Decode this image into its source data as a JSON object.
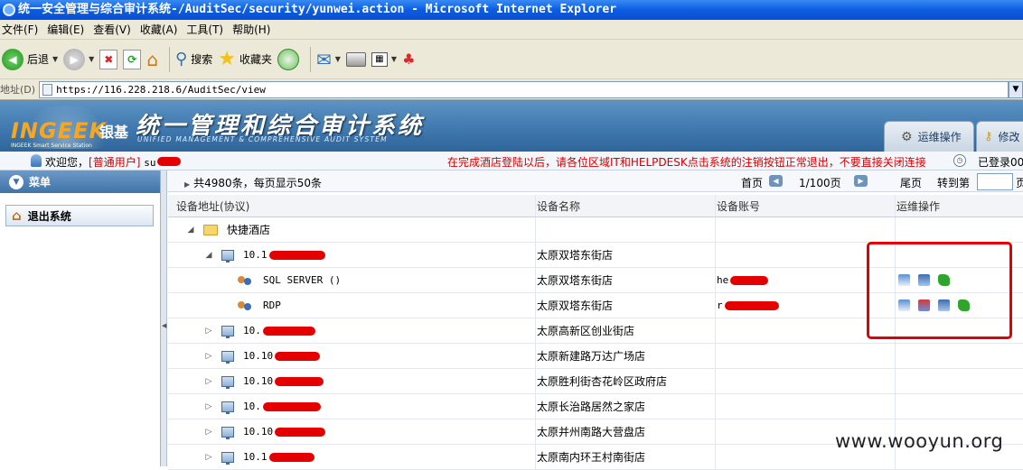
{
  "window": {
    "title": "统一安全管理与综合审计系统-/AuditSec/security/yunwei.action - Microsoft Internet Explorer"
  },
  "menubar": {
    "items": [
      "文件(F)",
      "编辑(E)",
      "查看(V)",
      "收藏(A)",
      "工具(T)",
      "帮助(H)"
    ]
  },
  "toolbar": {
    "back_label": "后退",
    "search_label": "搜索",
    "favorites_label": "收藏夹"
  },
  "addressbar": {
    "label": "地址(D)",
    "url": "https://116.228.218.6/AuditSec/view"
  },
  "app": {
    "logo_text": "INGEEK",
    "logo_cn": "银基",
    "logo_sub": "INGEEK Smart Service Station",
    "title": "统一管理和综合审计系统",
    "subtitle": "UNIFIED MANAGEMENT & COMPREHENSIVE AUDIT SYSTEM",
    "tabs": [
      "运维操作",
      "修改"
    ]
  },
  "welcome": {
    "greeting": "欢迎您，",
    "role": "[普通用户]",
    "user": "su",
    "notice": "在完成酒店登陆以后，请各位区域IT和HELPDESK点击系统的注销按钮正常退出，不要直接关闭连接",
    "logged": "已登录00"
  },
  "sidebar": {
    "header": "菜单",
    "logout": "退出系统"
  },
  "pager": {
    "summary": "共4980条，每页显示50条",
    "first": "首页",
    "page": "1/100页",
    "last": "尾页",
    "goto": "转到第",
    "page_suffix": "页"
  },
  "table": {
    "columns": [
      "设备地址(协议)",
      "设备名称",
      "设备账号",
      "运维操作"
    ],
    "group": "快捷酒店",
    "rows": [
      {
        "ip": "10.1",
        "name": "太原双塔东街店",
        "account": ""
      },
      {
        "ip": "SQL SERVER  ()",
        "name": "太原双塔东街店",
        "account": "he"
      },
      {
        "ip": "RDP",
        "name": "太原双塔东街店",
        "account": "r"
      },
      {
        "ip": "10.",
        "name": "太原高新区创业街店",
        "account": ""
      },
      {
        "ip": "10.10",
        "name": "太原新建路万达广场店",
        "account": ""
      },
      {
        "ip": "10.10",
        "name": "太原胜利街杏花岭区政府店",
        "account": ""
      },
      {
        "ip": "10.",
        "name": "太原长治路居然之家店",
        "account": ""
      },
      {
        "ip": "10.10",
        "name": "太原并州南路大营盘店",
        "account": ""
      },
      {
        "ip": "10.1",
        "name": "太原南内环王村南街店",
        "account": ""
      }
    ]
  },
  "watermark": "www.wooyun.org",
  "colors": {
    "title_bar": "#0b5de2",
    "header_blue": "#3e77ad",
    "notice_red": "#d40000",
    "highlight_red": "#e40000"
  }
}
